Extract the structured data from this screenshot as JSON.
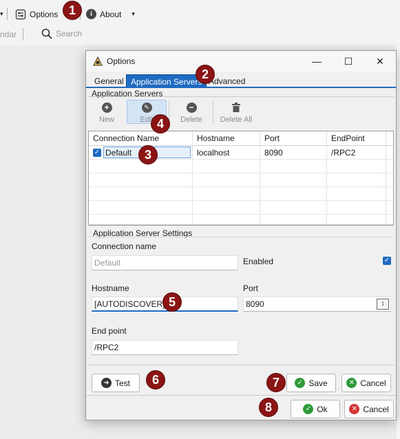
{
  "toolbar": {
    "options_label": "Options",
    "about_label": "About",
    "calendar_partial": "ndar",
    "search_label": "Search"
  },
  "badges": [
    "1",
    "2",
    "3",
    "4",
    "5",
    "6",
    "7",
    "8"
  ],
  "window": {
    "title": "Options",
    "controls": {
      "minimize": "—",
      "maximize": "☐",
      "close": "✕"
    }
  },
  "tabs": [
    "General",
    "Application Servers",
    "Advanced"
  ],
  "servers_group": {
    "title": "Application Servers",
    "tools": {
      "new": "New",
      "edit": "Edit",
      "delete": "Delete",
      "delete_all": "Delete All"
    }
  },
  "grid": {
    "columns": [
      "Connection Name",
      "Hostname",
      "Port",
      "EndPoint"
    ],
    "rows": [
      {
        "name": "Default",
        "hostname": "localhost",
        "port": "8090",
        "endpoint": "/RPC2",
        "checked": true
      }
    ]
  },
  "settings": {
    "title": "Application Server Settings",
    "connection_name_label": "Connection name",
    "connection_name_placeholder": "Default",
    "enabled_label": "Enabled",
    "hostname_label": "Hostname",
    "hostname_value": "[AUTODISCOVER]",
    "port_label": "Port",
    "port_value": "8090",
    "endpoint_label": "End point",
    "endpoint_value": "/RPC2"
  },
  "buttons": {
    "test": "Test",
    "save": "Save",
    "cancel_inner": "Cancel",
    "ok": "Ok",
    "cancel_outer": "Cancel"
  },
  "colors": {
    "accent": "#1f6bc1",
    "badge": "#8b1414",
    "success": "#2e9a3a",
    "danger": "#d33434"
  }
}
